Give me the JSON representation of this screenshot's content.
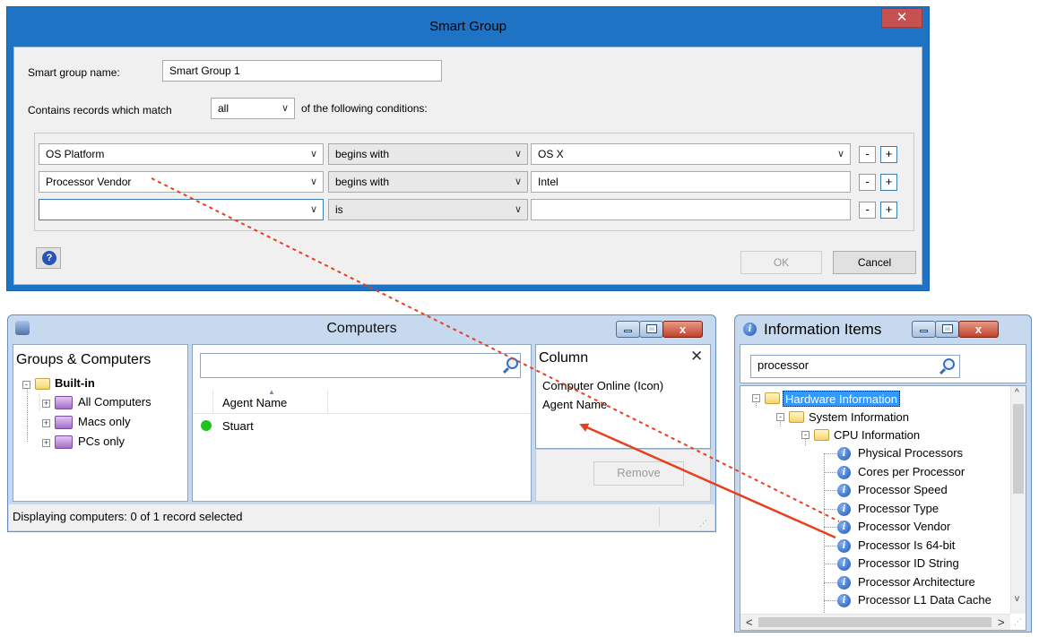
{
  "smart_group": {
    "title": "Smart Group",
    "close_glyph": "✕",
    "name_label": "Smart group name:",
    "name_value": "Smart Group 1",
    "match_prefix": "Contains records which match",
    "match_value": "all",
    "match_suffix": "of the following conditions:",
    "conditions": [
      {
        "field": "OS Platform",
        "operator": "begins with",
        "value": "OS X"
      },
      {
        "field": "Processor Vendor",
        "operator": "begins with",
        "value": "Intel"
      },
      {
        "field": "",
        "operator": "is",
        "value": ""
      }
    ],
    "minus_label": "-",
    "plus_label": "+",
    "help_glyph": "?",
    "ok_label": "OK",
    "cancel_label": "Cancel"
  },
  "computers": {
    "title": "Computers",
    "groups_header": "Groups & Computers",
    "tree": {
      "root": "Built-in",
      "children": [
        "All Computers",
        "Macs only",
        "PCs only"
      ]
    },
    "search_placeholder": "",
    "list_header": "Agent Name",
    "rows": [
      {
        "name": "Stuart",
        "status_color": "#1ec31e"
      }
    ],
    "column_header": "Column",
    "column_close": "✕",
    "columns": [
      "Computer Online (Icon)",
      "Agent Name"
    ],
    "remove_label": "Remove",
    "status": "Displaying computers: 0 of 1 record selected"
  },
  "info_items": {
    "title": "Information Items",
    "search_value": "processor",
    "tree": {
      "root": "Hardware Information",
      "level1": "System Information",
      "level2": "CPU Information",
      "items": [
        "Physical Processors",
        "Cores per Processor",
        "Processor Speed",
        "Processor Type",
        "Processor Vendor",
        "Processor Is 64-bit",
        "Processor ID String",
        "Processor Architecture",
        "Processor L1 Data Cache"
      ]
    },
    "scroll_left": "<",
    "scroll_right": ">",
    "scroll_up": "^",
    "scroll_down": "v"
  },
  "colors": {
    "dialog_frame": "#1f73c5",
    "arrow": "#e8401c",
    "selection": "#3399ff"
  }
}
